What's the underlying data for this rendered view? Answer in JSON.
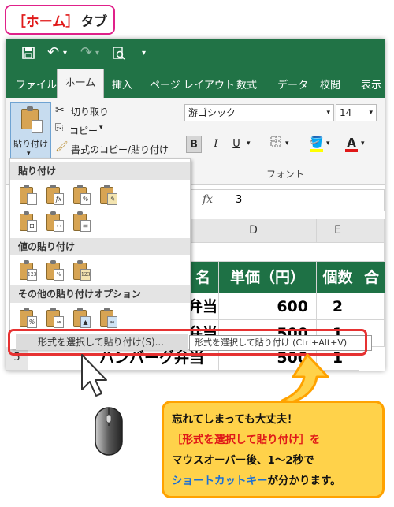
{
  "tag": {
    "bracket_label": "［ホーム］",
    "suffix": "タブ"
  },
  "qat": {
    "save_icon": "save-icon",
    "undo_icon": "undo-icon",
    "redo_icon": "redo-icon",
    "preview_icon": "print-preview-icon",
    "more": "▾"
  },
  "tabs": [
    "ファイル",
    "ホーム",
    "挿入",
    "ページ レイアウト",
    "数式",
    "データ",
    "校閲",
    "表示"
  ],
  "clipboard": {
    "paste_label": "貼り付け",
    "cut_label": "切り取り",
    "copy_label": "コピー",
    "format_painter_label": "書式のコピー/貼り付け"
  },
  "font": {
    "name": "游ゴシック",
    "size": "14",
    "group_label": "フォント",
    "bold": "B",
    "italic": "I",
    "underline": "U",
    "font_color_letter": "A"
  },
  "formula_bar": {
    "fx": "fx",
    "value": "3"
  },
  "columns": [
    "D",
    "E"
  ],
  "header_row": {
    "partial": "名",
    "unit_price": "単価（円）",
    "count": "個数",
    "total": "合計"
  },
  "rows": [
    {
      "name_partial": "弁当",
      "price": "600",
      "count": "2"
    },
    {
      "name_partial": "弁当",
      "price": "500",
      "count": "1"
    },
    {
      "row_no": "5",
      "name": "ハンバーグ弁当",
      "price": "500",
      "count": "1"
    }
  ],
  "paste_menu": {
    "section_paste": "貼り付け",
    "section_values": "値の貼り付け",
    "section_other": "その他の貼り付けオプション",
    "special_label": "形式を選択して貼り付け(S)..."
  },
  "tooltip_text": "形式を選択して貼り付け (Ctrl+Alt+V)",
  "callout": {
    "line1": "忘れてしまっても大丈夫！",
    "line2": "［形式を選択して貼り付け］を",
    "line3": "マウスオーバー後、1～2秒で",
    "line4_blue": "ショートカットキー",
    "line4_rest": "が分かります。"
  },
  "colors": {
    "excel_green": "#217346",
    "accent_red": "#e63232",
    "callout_bg": "#ffd24a",
    "callout_border": "#ffa200",
    "highlight_blue": "#1a6fd6"
  }
}
